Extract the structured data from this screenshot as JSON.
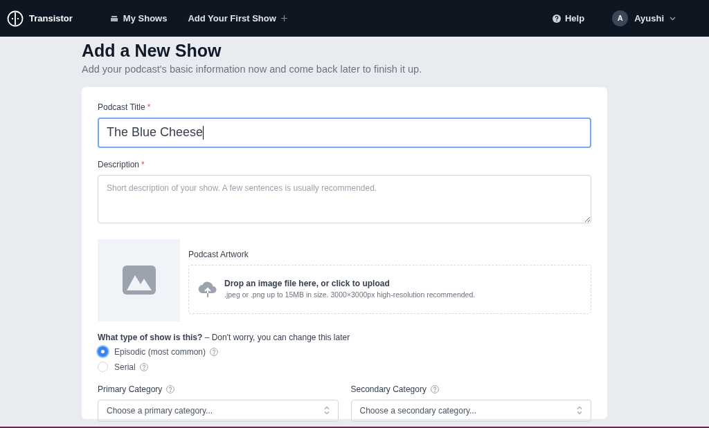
{
  "navbar": {
    "brand": "Transistor",
    "links": [
      {
        "label": "My Shows",
        "kind": "shows"
      },
      {
        "label": "Add Your First Show",
        "kind": "add"
      }
    ],
    "help": "Help",
    "user": {
      "initial": "A",
      "name": "Ayushi"
    }
  },
  "page": {
    "title": "Add a New Show",
    "subtitle": "Add your podcast's basic information now and come back later to finish it up."
  },
  "form": {
    "title_field": {
      "label": "Podcast Title",
      "required_mark": "*",
      "value": "The Blue Cheese"
    },
    "description_field": {
      "label": "Description",
      "required_mark": "*",
      "placeholder": "Short description of your show. A few sentences is usually recommended."
    },
    "artwork": {
      "label": "Podcast Artwork",
      "drop_text": "Drop an image file here, or click to upload",
      "hint": ".jpeg or .png up to 15MB in size. 3000×3000px high-resolution recommended."
    },
    "show_type": {
      "question": "What type of show is this?",
      "note": "– Don't worry, you can change this later",
      "options": [
        {
          "label": "Episodic (most common)",
          "selected": true
        },
        {
          "label": "Serial",
          "selected": false
        }
      ]
    },
    "categories": [
      {
        "label": "Primary Category",
        "placeholder": "Choose a primary category..."
      },
      {
        "label": "Secondary Category",
        "placeholder": "Choose a secondary category..."
      }
    ]
  }
}
